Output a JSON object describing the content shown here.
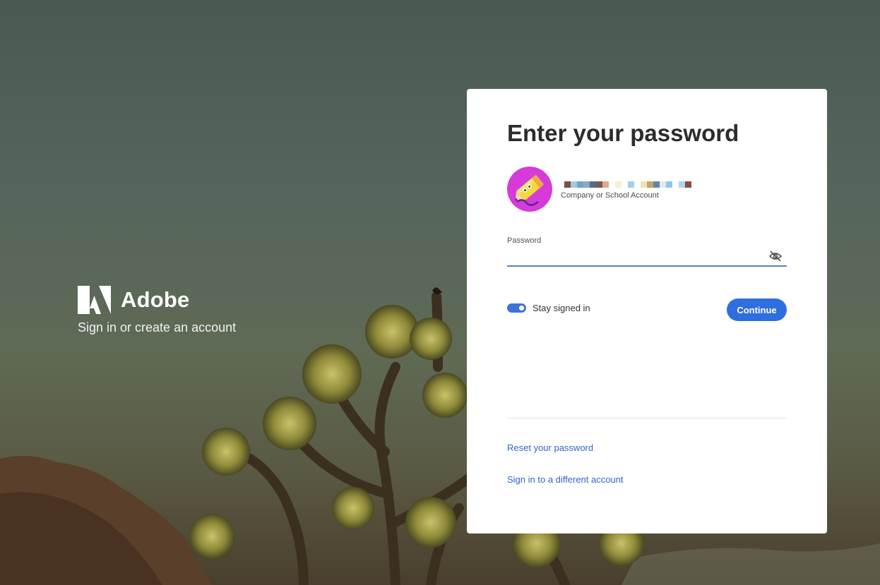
{
  "brand": {
    "name": "Adobe",
    "tagline": "Sign in or create an account"
  },
  "card": {
    "title": "Enter your password",
    "account": {
      "type_label": "Company or School Account",
      "avatar_icon": "pencil-avatar-icon"
    },
    "password": {
      "label": "Password",
      "value": "",
      "placeholder": "",
      "visibility_icon": "eye-off-icon"
    },
    "stay_signed_in": {
      "label": "Stay signed in",
      "enabled": true
    },
    "continue_label": "Continue",
    "links": {
      "reset_password": "Reset your password",
      "different_account": "Sign in to a different account"
    }
  },
  "colors": {
    "accent": "#2f6ee0",
    "link": "#2f65c8",
    "avatar_bg": "#d63ad9",
    "avatar_pencil": "#f3d93b"
  }
}
